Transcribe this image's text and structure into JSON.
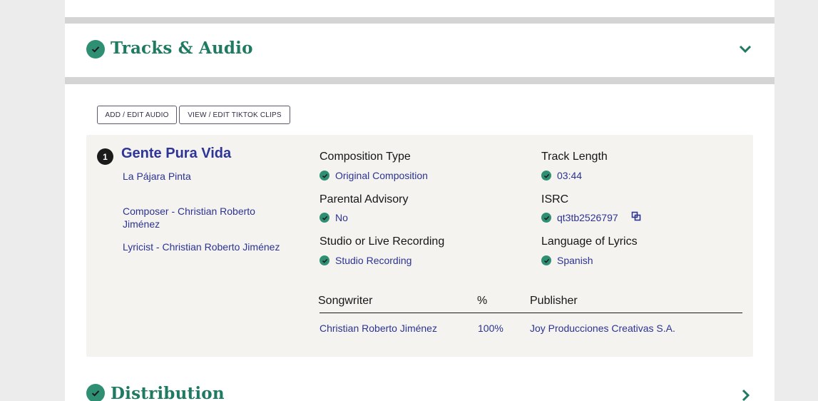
{
  "sections": {
    "tracks": {
      "title": "Tracks & Audio",
      "status_icon": "check-icon",
      "toggle_icon": "chevron-down-icon"
    },
    "distribution": {
      "title": "Distribution",
      "status_icon": "check-icon",
      "toggle_icon": "chevron-right-icon"
    }
  },
  "toolbar": {
    "add_audio_label": "ADD / EDIT AUDIO",
    "tiktok_label": "VIEW / EDIT TIKTOK CLIPS"
  },
  "track": {
    "number": "1",
    "title": "Gente Pura Vida",
    "artist": "La Pájara Pinta",
    "composer": "Composer - Christian Roberto Jiménez",
    "lyricist": "Lyricist - Christian Roberto Jiménez",
    "fields": {
      "composition_type": {
        "label": "Composition Type",
        "value": "Original Composition"
      },
      "track_length": {
        "label": "Track Length",
        "value": "03:44"
      },
      "parental_advisory": {
        "label": "Parental Advisory",
        "value": "No"
      },
      "isrc": {
        "label": "ISRC",
        "value": "qt3tb2526797",
        "action_icon": "copy-icon"
      },
      "recording": {
        "label": "Studio or Live Recording",
        "value": "Studio Recording"
      },
      "language": {
        "label": "Language of Lyrics",
        "value": "Spanish"
      }
    },
    "splits": {
      "headers": {
        "songwriter": "Songwriter",
        "percent": "%",
        "publisher": "Publisher"
      },
      "rows": [
        {
          "songwriter": "Christian Roberto Jiménez",
          "percent": "100%",
          "publisher": "Joy Producciones Creativas S.A."
        }
      ]
    }
  },
  "colors": {
    "accent_green": "#2f8f72",
    "title_green": "#1f7a62",
    "link_blue": "#2c3391",
    "panel_bg": "#f4f3f0"
  }
}
